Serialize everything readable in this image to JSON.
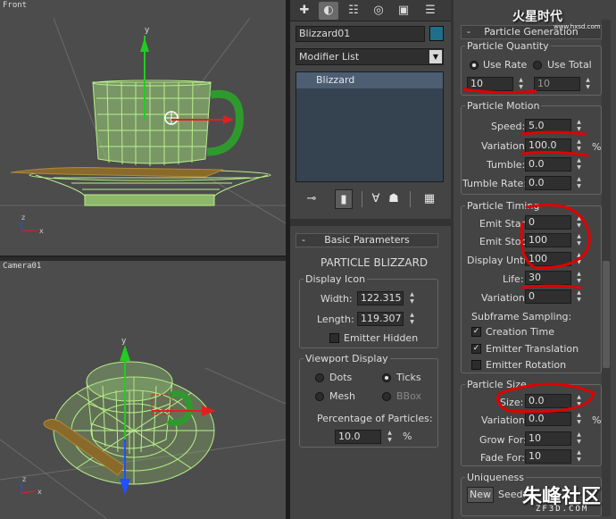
{
  "viewports": {
    "front_label": "Front",
    "camera_label": "Camera01",
    "axis_y": "y",
    "axis_x": "x",
    "axis_z": "z"
  },
  "command_panel": {
    "tabs": [
      "create-icon",
      "modify-icon",
      "hierarchy-icon",
      "motion-icon",
      "display-icon",
      "utilities-icon"
    ],
    "object_name": "Blizzard01",
    "object_color": "#1f6f8b",
    "modifier_list": "Modifier List",
    "stack_items": [
      "Blizzard"
    ]
  },
  "basic_parameters": {
    "minus": "-",
    "title": "Basic Parameters",
    "object_type": "PARTICLE BLIZZARD",
    "display_icon": {
      "group": "Display Icon",
      "width_label": "Width:",
      "width_value": "122.315",
      "length_label": "Length:",
      "length_value": "119.307",
      "emitter_hidden": "Emitter Hidden"
    },
    "viewport_display": {
      "group": "Viewport Display",
      "dots": "Dots",
      "ticks": "Ticks",
      "mesh": "Mesh",
      "bbox": "BBox",
      "percentage_label": "Percentage of Particles:",
      "percentage_value": "10.0",
      "percent_sign": "%"
    }
  },
  "particle_generation": {
    "minus": "-",
    "title": "Particle Generation",
    "quantity": {
      "group": "Particle Quantity",
      "use_rate": "Use Rate",
      "use_total": "Use Total",
      "rate_value": "10",
      "total_value": "10"
    },
    "motion": {
      "group": "Particle Motion",
      "speed_label": "Speed:",
      "speed_value": "5.0",
      "variation_label": "Variation:",
      "variation_value": "100.0",
      "percent_sign": "%",
      "tumble_label": "Tumble:",
      "tumble_value": "0.0",
      "tumble_rate_label": "Tumble Rate:",
      "tumble_rate_value": "0.0"
    },
    "timing": {
      "group": "Particle Timing",
      "emit_start_label": "Emit Start",
      "emit_start_value": "0",
      "emit_stop_label": "Emit Stop",
      "emit_stop_value": "100",
      "display_until_label": "Display Until",
      "display_until_value": "100",
      "life_label": "Life:",
      "life_value": "30",
      "variation_label": "Variation:",
      "variation_value": "0",
      "subframe_label": "Subframe Sampling:",
      "creation_time": "Creation Time",
      "emitter_translation": "Emitter Translation",
      "emitter_rotation": "Emitter Rotation"
    },
    "size": {
      "group": "Particle Size",
      "size_label": "Size:",
      "size_value": "0.0",
      "variation_label": "Variation:",
      "variation_value": "0.0",
      "percent_sign": "%",
      "grow_for_label": "Grow For:",
      "grow_for_value": "10",
      "fade_for_label": "Fade For:",
      "fade_for_value": "10"
    },
    "uniqueness": {
      "group": "Uniqueness",
      "new_button": "New",
      "seed_label": "Seed:"
    }
  },
  "watermarks": {
    "top": "火星时代",
    "top_sub": "www.hxsd.com",
    "bottom": "朱峰社区",
    "bottom_sub": "ZF3D.COM"
  },
  "colors": {
    "wire": "#b8f08a",
    "annotation": "#e00000",
    "gizmo_green": "#22cc22",
    "gizmo_red": "#e02020",
    "gizmo_blue": "#2050ff"
  }
}
